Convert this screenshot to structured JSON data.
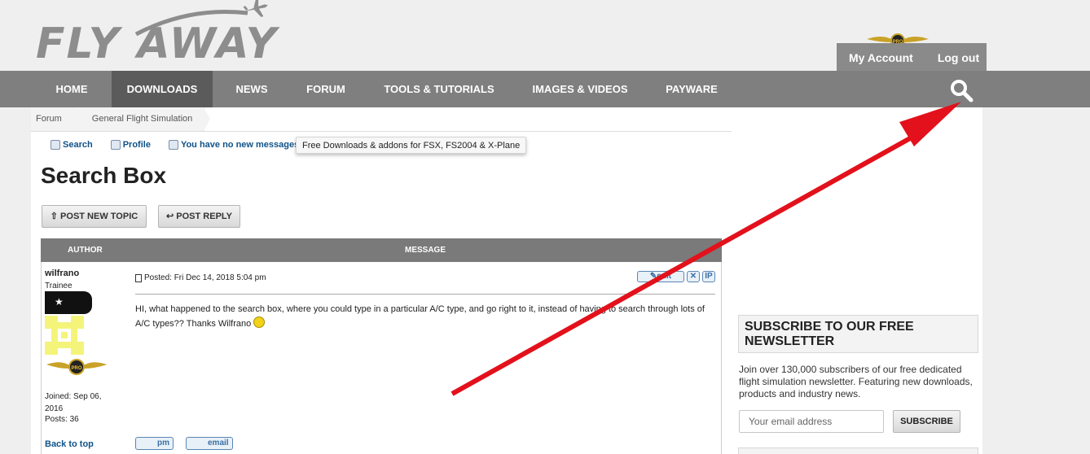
{
  "site": {
    "logo_text": "FLY AWAY"
  },
  "account": {
    "my_account": "My Account",
    "log_out": "Log out"
  },
  "nav": {
    "items": [
      "HOME",
      "DOWNLOADS",
      "NEWS",
      "FORUM",
      "TOOLS & TUTORIALS",
      "IMAGES & VIDEOS",
      "PAYWARE"
    ],
    "active": "DOWNLOADS"
  },
  "breadcrumb": [
    "Forum",
    "General Flight Simulation"
  ],
  "toolbar": {
    "search": "Search",
    "profile": "Profile",
    "messages": "You have no new messages"
  },
  "tooltip": "Free Downloads & addons for FSX, FS2004 & X-Plane",
  "page_title": "Search Box",
  "buttons": {
    "new_topic": "⇧ POST NEW TOPIC",
    "reply": "↩ POST REPLY"
  },
  "table": {
    "author_header": "AUTHOR",
    "message_header": "MESSAGE"
  },
  "post": {
    "author": "wilfrano",
    "rank": "Trainee",
    "joined": "Joined: Sep 06, 2016",
    "posts": "Posts: 36",
    "back_to_top": "Back to top",
    "posted": "Posted: Fri Dec 14, 2018 5:04 pm",
    "edit": "edit",
    "ip": "IP",
    "body": "HI, what happened to the search box, where you could type in a particular A/C type, and go right to it, instead of having to search through lots of A/C types?? Thanks Wilfrano",
    "pm": "pm",
    "email": "email"
  },
  "newsletter": {
    "title": "SUBSCRIBE TO OUR FREE NEWSLETTER",
    "text": "Join over 130,000 subscribers of our free dedicated flight simulation newsletter. Featuring new downloads, products and industry news.",
    "placeholder": "Your email address",
    "button": "SUBSCRIBE"
  },
  "colors": {
    "nav_bg": "#7f7f7f",
    "nav_active": "#5b5b5b",
    "link": "#105289",
    "arrow": "#e3111b"
  },
  "icons": [
    "airplane-icon",
    "pro-wings-icon",
    "search-icon",
    "magnifier-icon",
    "profile-icon",
    "messages-icon",
    "document-icon",
    "edit-icon",
    "delete-icon",
    "smiley-icon",
    "pm-icon",
    "email-icon"
  ]
}
